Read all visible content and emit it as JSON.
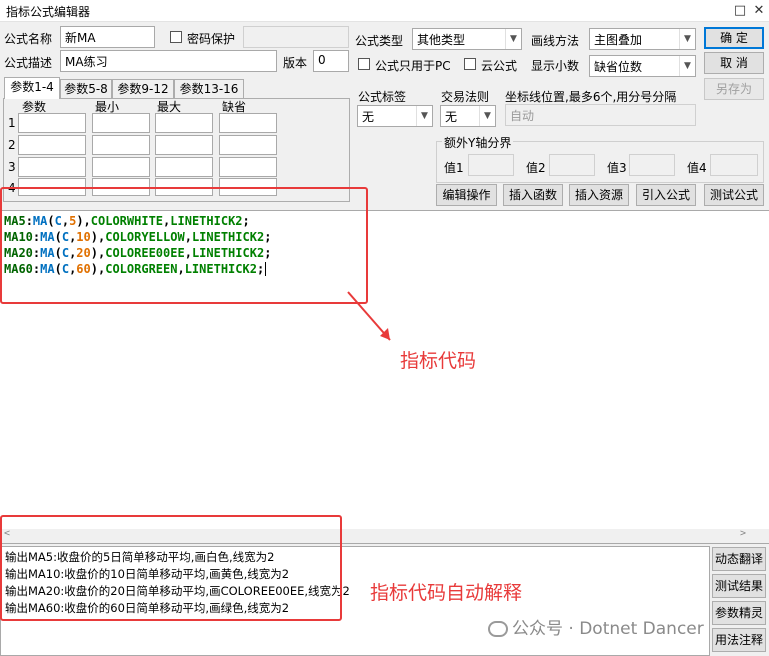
{
  "window": {
    "title": "指标公式编辑器",
    "maximize_glyph": "□",
    "close_glyph": "✕"
  },
  "row1": {
    "name_label": "公式名称",
    "name_value": "新MA",
    "password_label": "密码保护",
    "type_label": "公式类型",
    "type_value": "其他类型",
    "draw_label": "画线方法",
    "draw_value": "主图叠加",
    "ok_button": "确 定"
  },
  "row2": {
    "desc_label": "公式描述",
    "desc_value": "MA练习",
    "version_label": "版本",
    "version_value": "0",
    "pc_only_label": "公式只用于PC",
    "cloud_label": "云公式",
    "decimal_label": "显示小数",
    "decimal_value": "缺省位数",
    "cancel_button": "取 消"
  },
  "row3": {
    "tag_label": "公式标签",
    "tag_value": "无",
    "rule_label": "交易法则",
    "rule_value": "无",
    "coord_label": "坐标线位置,最多6个,用分号分隔",
    "coord_value": "自动",
    "save_as_button": "另存为"
  },
  "tabs": [
    "参数1-4",
    "参数5-8",
    "参数9-12",
    "参数13-16"
  ],
  "param_table": {
    "headers": [
      "参数",
      "最小",
      "最大",
      "缺省"
    ],
    "rows": [
      "1",
      "2",
      "3",
      "4"
    ]
  },
  "y_axis_group": {
    "title": "额外Y轴分界",
    "labels": [
      "值1",
      "值2",
      "值3",
      "值4"
    ]
  },
  "toolbar": [
    "编辑操作",
    "插入函数",
    "插入资源",
    "引入公式",
    "测试公式"
  ],
  "code_lines": [
    [
      [
        "MA5",
        "#006400"
      ],
      [
        ":",
        "#000000"
      ],
      [
        "MA",
        "#0070c0"
      ],
      [
        "(",
        "#000000"
      ],
      [
        "C",
        "#0070c0"
      ],
      [
        ",",
        "#000000"
      ],
      [
        "5",
        "#e07000"
      ],
      [
        ")",
        "#000000"
      ],
      [
        ",",
        "#000000"
      ],
      [
        "COLORWHITE",
        "#008000"
      ],
      [
        ",",
        "#000000"
      ],
      [
        "LINETHICK2",
        "#008000"
      ],
      [
        ";",
        "#000000"
      ]
    ],
    [
      [
        "MA10",
        "#006400"
      ],
      [
        ":",
        "#000000"
      ],
      [
        "MA",
        "#0070c0"
      ],
      [
        "(",
        "#000000"
      ],
      [
        "C",
        "#0070c0"
      ],
      [
        ",",
        "#000000"
      ],
      [
        "10",
        "#e07000"
      ],
      [
        ")",
        "#000000"
      ],
      [
        ",",
        "#000000"
      ],
      [
        "COLORYELLOW",
        "#008000"
      ],
      [
        ",",
        "#000000"
      ],
      [
        "LINETHICK2",
        "#008000"
      ],
      [
        ";",
        "#000000"
      ]
    ],
    [
      [
        "MA20",
        "#006400"
      ],
      [
        ":",
        "#000000"
      ],
      [
        "MA",
        "#0070c0"
      ],
      [
        "(",
        "#000000"
      ],
      [
        "C",
        "#0070c0"
      ],
      [
        ",",
        "#000000"
      ],
      [
        "20",
        "#e07000"
      ],
      [
        ")",
        "#000000"
      ],
      [
        ",",
        "#000000"
      ],
      [
        "COLOREE00EE",
        "#008000"
      ],
      [
        ",",
        "#000000"
      ],
      [
        "LINETHICK2",
        "#008000"
      ],
      [
        ";",
        "#000000"
      ]
    ],
    [
      [
        "MA60",
        "#006400"
      ],
      [
        ":",
        "#000000"
      ],
      [
        "MA",
        "#0070c0"
      ],
      [
        "(",
        "#000000"
      ],
      [
        "C",
        "#0070c0"
      ],
      [
        ",",
        "#000000"
      ],
      [
        "60",
        "#e07000"
      ],
      [
        ")",
        "#000000"
      ],
      [
        ",",
        "#000000"
      ],
      [
        "COLORGREEN",
        "#008000"
      ],
      [
        ",",
        "#000000"
      ],
      [
        "LINETHICK2",
        "#008000"
      ],
      [
        ";",
        "#000000"
      ]
    ]
  ],
  "explain_lines": [
    "输出MA5:收盘价的5日简单移动平均,画白色,线宽为2",
    "输出MA10:收盘价的10日简单移动平均,画黄色,线宽为2",
    "输出MA20:收盘价的20日简单移动平均,画COLOREE00EE,线宽为2",
    "输出MA60:收盘价的60日简单移动平均,画绿色,线宽为2"
  ],
  "side_buttons": [
    "动态翻译",
    "测试结果",
    "参数精灵",
    "用法注释"
  ],
  "annotations": {
    "code": "指标代码",
    "explain": "指标代码自动解释"
  },
  "watermark": "公众号 · Dotnet Dancer",
  "colors": {
    "annotation": "#e83a3a",
    "focus_border": "#0078d7"
  }
}
